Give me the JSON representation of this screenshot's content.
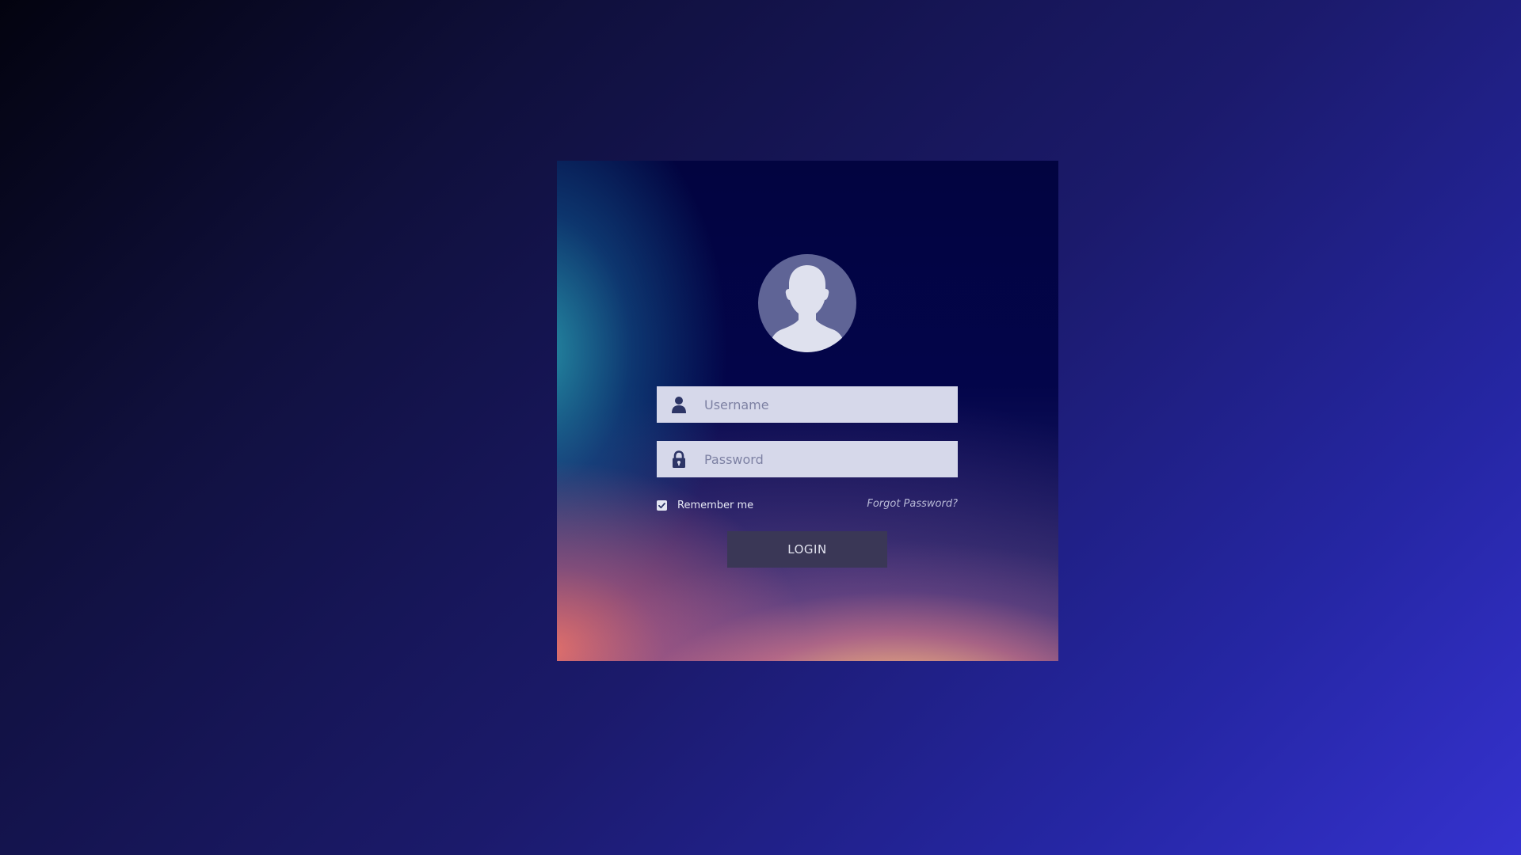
{
  "login_form": {
    "username": {
      "placeholder": "Username",
      "value": "",
      "icon": "user-icon"
    },
    "password": {
      "placeholder": "Password",
      "value": "",
      "icon": "lock-icon"
    },
    "remember": {
      "label": "Remember me",
      "checked": true
    },
    "forgot_password": "Forgot Password?",
    "login_button": "LOGIN",
    "avatar_icon": "user-avatar-icon"
  },
  "colors": {
    "input_background": "#d6d8ea",
    "button_background": "#3a3756",
    "icon_color": "#2d3566",
    "avatar_background": "#5f6496"
  }
}
